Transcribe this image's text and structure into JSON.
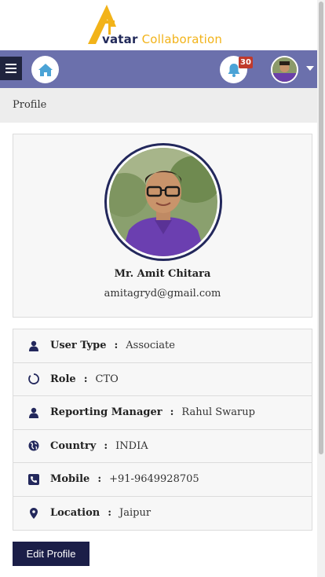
{
  "brand": {
    "logo_main": "vatar",
    "logo_sub": "Collaboration",
    "logo_letter": "A"
  },
  "topnav": {
    "menu_icon": "hamburger-icon",
    "home_icon": "home-icon",
    "notification_icon": "bell-icon",
    "notification_count": "30",
    "dropdown_icon": "caret-down-icon"
  },
  "breadcrumb": {
    "title": "Profile"
  },
  "profile": {
    "name": "Mr. Amit Chitara",
    "email": "amitagryd@gmail.com"
  },
  "details": [
    {
      "icon": "user-icon",
      "label": "User Type",
      "sep": ":",
      "value": "Associate"
    },
    {
      "icon": "circle-notch-icon",
      "label": "Role",
      "sep": ":",
      "value": "CTO"
    },
    {
      "icon": "user-icon",
      "label": "Reporting Manager",
      "sep": ":",
      "value": "Rahul Swarup"
    },
    {
      "icon": "globe-icon",
      "label": "Country",
      "sep": ":",
      "value": "INDIA"
    },
    {
      "icon": "phone-icon",
      "label": "Mobile",
      "sep": ":",
      "value": "+91-9649928705"
    },
    {
      "icon": "map-marker-icon",
      "label": "Location",
      "sep": ":",
      "value": "Jaipur"
    }
  ],
  "actions": {
    "edit_label": "Edit Profile"
  },
  "colors": {
    "navbar": "#6b70ac",
    "navy": "#1b1e48",
    "accent": "#f2b319",
    "badge": "#c0392b"
  }
}
